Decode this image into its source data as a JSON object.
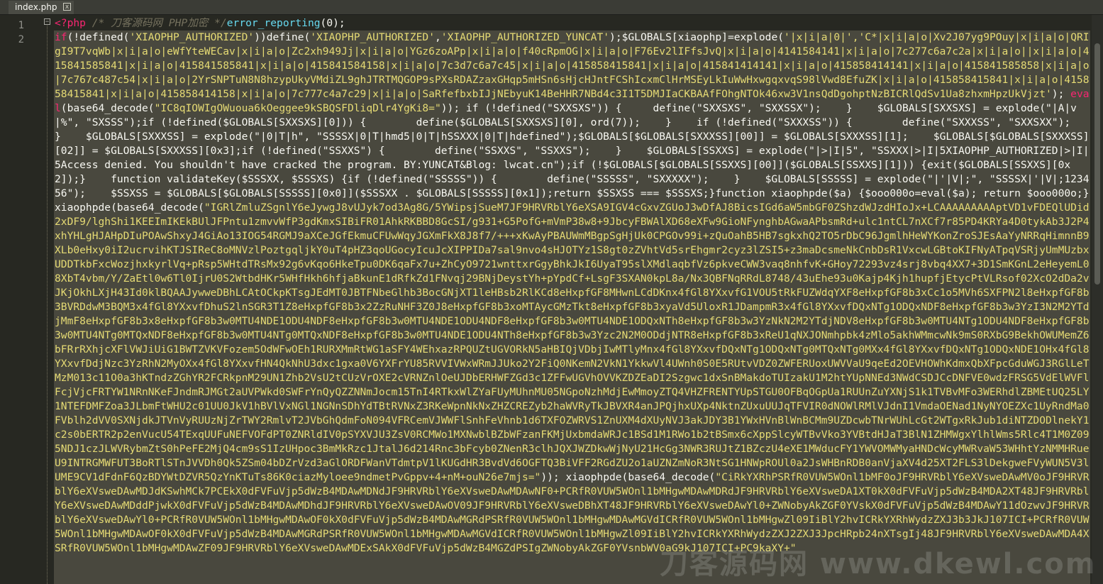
{
  "tab": {
    "title": "index.php",
    "close_glyph": "x"
  },
  "gutter": {
    "lines": [
      "1",
      "2"
    ]
  },
  "fold_glyph": "−",
  "line1": {
    "open_tag": "<?php",
    "comment": " /* 刀客源码网 PHP加密 */",
    "statement": "error_reporting",
    "arg": "(0);"
  },
  "code": {
    "p1_kw": "if",
    "p1": "(!defined(",
    "p1_s1": "'XIAOPHP_AUTHORIZED'",
    "p1b": "))define(",
    "p1_s2": "'XIAOPHP_AUTHORIZED'",
    "p1c": ",",
    "p1_s3": "'XIAOPHP_AUTHORIZED_YUNCAT'",
    "p1d": ");$GLOBALS[xiaophp]=explode(",
    "blob1": "'|x|i|a|0|','C*|x|i|a|o|Xv2J07yg9POuy|x|i|a|o|QRIgI9T7vqWb|x|i|a|o|eWfYteWECav|x|i|a|o|Zc2xh949Jj|x|i|a|o|YGz6zoAPp|x|i|a|o|f40cRpmOG|x|i|a|o|F76Ev2lIFfsJvQ|x|i|a|o|4141584141|x|i|a|o|7c277c6a7c2a|x|i|a|o||x|i|a|o|415841585841|x|i|a|o|415841585841|x|i|a|o|415841584158|x|i|a|o|7c3d7c6a7c45|x|i|a|o|415858415841|x|i|a|o|415841414141|x|i|a|o|415858414141|x|i|a|o|415841585858|x|i|a|o|7c767c487c54|x|i|a|o|2YrSNPTuN8N8hzypUkyVMdiZL9ghJTRTMQGOP9sPXsRDAZzaxGHqp5mHSn6sHjcHJntFCShIcxmClHrMSEyLkIuWwHxwgqxvqS98lVwd8EfuZK|x|i|a|o|415858415841|x|i|a|o|415858415841|x|i|a|o|415858414158|x|i|a|o|7c777c4a7c29|x|i|a|o|SaRfefbxbIJjNEbyuK14BeHHR7NBd4c3I1T5DMJIaCKBAAfFOhgNTOk46xw3V1nsQdDgohptNzBICRlQdSv1Ua8zhxmHpzUkVjzt'",
    "p2": "); ",
    "eval_kw": "eval",
    "p3": "(base64_decode(",
    "blob2": "\"IC8qIOWIgOWuoua6kOeggee9kSBQSFDliqDlr4YgKi8=\"",
    "p4": ")); if (!defined(\"SXXSXS\")) {     define(\"SXXSXS\", \"SXXSSX\");    }    $GLOBALS[SXXSXS] = explode(\"|A|v|%\", \"SXSSS\");if (!defined($GLOBALS[SXXSXS][0])) {        define($GLOBALS[SXXSXS][0], ord(7));    }    if (!defined(\"SXXXSS\")) {        define(\"SXXXSS\", \"SXXSXX\");    }    $GLOBALS[SXXXSS] = explode(\"|0|T|h\", \"SSSSX|0|T|hmd5|0|T|hSSXXX|0|T|hdefined\");$GLOBALS[$GLOBALS[SXXXSS][00]] = $GLOBALS[SXXXSS][1];    $GLOBALS[$GLOBALS[SXXXSS][02]] = $GLOBALS[SXXXSS][0x3];if (!defined(\"SSXXS\") {        define(\"SSXXS\", \"SSXXS\");    }    $GLOBALS[SSXXS] = explode(\"|>|I|5\", \"SSXXX|>|I|5XIAOPHP_AUTHORIZED|>|I|5Access denied. You shouldn't have cracked the program. BY:YUNCAT&Blog: lwcat.cn\");if (!$GLOBALS[$GLOBALS[SSXXS][00]]($GLOBALS[SSXXS][1])) {exit($GLOBALS[SSXXS][0x2]);}    function validateKey($SSSXX, $SSSXS) {if (!defined(\"SSSSS\")) {        define(\"SSSSS\", \"SXXXXX\");    }    $GLOBALS[SSSSS] = explode(\"|'|V|;\", \"SSSSX|'|V|;123456\");    $SSXSS = $GLOBALS[$GLOBALS[SSSSS][0x0]]($SSSXX . $GLOBALS[SSSSS][0x1]);return $SSXSS === $SSSXS;}function xiaophpde($a) {$ooo000o=eval($a); return $ooo000o;}     xiaophpde(base64_decode(",
    "blob3": "\"IGRlZmluZSgnlY6eJywgJ8vUJyk7od3Ag8G/5YWipsjSueM7JF9HRVRblY6eXSA9IGV4cGxvZGUoJ3wDfAJ8BicsIGd6aW5mbGF0ZShzdWJzdHIoJx+LCAAAAAAAAAptVD1vFDEQlUDid2xDF9/lghShi1KEEImIKEkBUlJFPntu1zmvvWfP3gdKmxSIBiFR01AhkRKBBD8GcSI/g931+G5PofG+mVmP38w8+9JbcyFBWAlXD68eXFw9GioNFynghbAGwaAPbsmRd+ulc1ntCL7nXCf7r85PD4KRYa4D0tykAb3J2P4xhYHLgHJAHpDIuPOAwShxyJ4GiAo13IOG54RGMJ9aXCeJGfEkmuCFUwWqyJGXmFkX8J8f7/+++xKwAyPBAUWmMBgpSgHjUk0CPGOv99i+zQuOahB5HB7sgkxhQ2TO5rDbC96JgmlhHeWYKonZroSJEsAaYyNRRqHimnnB9XLb0eHxy0iI2ucrvihKTJSIReC8oMNVzlPoztgqljkY0uT4pHZ3qoUGocyIcuJcXIPPIDa7sal9nvo4sHJOTYz1S8gt0zZVhtVd5srEhgmr2cyz3lZSI5+z3maDcsmeNkCnbDsR1VxcwLGBtoKIFNyATpqVSRjyUmMUzbxUDDTkbFxcWozjhxkyrlVq+pRsp5WHtdTRsMx92g6vKqo6HkeTpu0DK6qaFx7u+ZhCyO9721wnttxrGgyBhkJkI6UyaT95slXMdlaqbfVz6pkveCWW3vaq8nhfvK+GHoy72293vz4srj8vbq4XX7+3D1SmKGnL2eHeyemL08XbT4vbm/Y/ZaEtl0w6Tl0IjrU0S2WtbdHKr5WHfHkh6hfjaBkunE1dRfkZd1FNvqj29BNjDeystYh+pYpdCf+LsgF3SXAN0kpL8a/Nx3QBFNqRRdL8748/43uEhe93u0Kajp4Kjh1hupfjEtycPtVLRsof02XcO2dDa2vJKjOkhLXjH43Id0klBQAAJywweDBhLCAtOCkpKTsgJEdMT0JBTFNbeGlhb3BocGNjXT1leHBsb2RlKCd8eHxpfGF8MHwnLCdDKnx4fGl8YXxvfG1VOU5tRkFUZWdqYXF8eHxpfGF8b3xCc1o5MVh6SXFPN2l8eHxpfGF8b3BVRDdwM3BQM3x4fGl8YXxvfDhuS2lnSGR3T1Z8eHxpfGF8b3x2ZzRuNHF3Z0J8eHxpfGF8b3xoMTAycGMzTkt8eHxpfGF8b3xyaVd5UloxR1JDampmR3x4fGl8YXxvfDQxNTg1ODQxNDF8eHxpfGF8b3w3YzI3N2M2YTdjMmF8eHxpfGF8b3x8eHxpfGF8b3w0MTU4NDE1ODU4NDF8eHxpfGF8b3w0MTU4NDE1ODU4NDF8eHxpfGF8b3w0MTU4NDE1ODQxNTh8eHxpfGF8b3w3YzNkN2M2YTdjNDV8eHxpfGF8b3w0MTU4NTg1ODU4NDF8eHxpfGF8b3w0MTU4NTg0MTQxNDF8eHxpfGF8b3w0MTU4NTg0MTQxNDF8eHxpfGF8b3w0MTU4NDE1ODU4NTh8eHxpfGF8b3w3Yzc2N2M0ODdjNTR8eHxpfGF8b3xReU1qNXJONmhpbk4zMlo5akhWMmcwNk9mS0RXbG9BekhOWUMemZ6bFRrRXhjcXFlVWJiUiG1BWTZVKVFozem5OdWFwOEh1RURXMmRtWG1aSFY4WEhxazRPQUZtUGVORkN5aHBIQjVDbjIwMTlyMnx4fGl8YXxvfDQxNTg1ODQxNTg0MTQxNTg0MXx4fGl8YXxvfDQxNTg1ODQxNDE1OHx4fGl8YXxvfDdjNzc3YzRhN2MyOXx4fGl8YXxvfHN4QkNhU3dxc1gxa0V6YXFrYU85RVVIVWxWRmJJUko2Y2FiQ0NKemN2VkN1YkkwVl4UWnh0S0E5RUtvVDZ0ZWFERUoxUWVVaU9qeEd2OEVHOWhKdmxQbXFpcGduWGJ3RGlLeTMzM013c11O0a3hKTndzZGhYR2FCRkpnM29UN1Zhb2VsU2tCUzVrOXE2cVRNZnlOeUJDbERHWFZGd3c1ZFFwUGVhOVVKZDZEaDI2Szgwc1dxSnBMakdoTUIzakU1M2htYUpNNEd3NWdCSDJCcDNFVE0wdzFRSG5VdElWVFlFcjVjcFRTYW1NRnNKeFJndmRJMGt2aUVPWkd0SWFrYnQyQZZNNmJocm15TnI4RTkxWlZYaFUyMUhnMU05NGpoNzhMdjEwMmoyZTQ4VHZFRENTYUpSTGU0OFBqOGpUa1RUUnZuYXNjS1k1TVBvMFo3WERhdlZBMEtUQ25LY1NTEFDMFZoa3JLbmFtWHU2c01UU0JkV1hBVlVxNGl1NGNnSDhYdTBtRVNxZ3RKeWpnNkNxZHZCREZyb2haWVRyTkJBVXR4anJPQjhxUXp4NktnZUxuUUJqTFVIR0dNOWlRMlVJdnI1VmdaOENad1NyNYOEZXc1UyRndMa0FVblh2dVV0SXNjdkJTVnVyRUUzNjZrTWY2RmlvT2JVbGhQdmFoN094VFRCemVJWWFlSnhFeVhnb1d6TXFOZWRVS1ZnUXM4dXUyNVJ3akJDY3B1YWxHVnBlWnBCMm9UZDcwbTNrWUhLcGt2WTgxRkJub1diNTZDODlnekY1c2s0bERTR2p2enVucU54TExqUUFuNEFVOFdPT0ZNRldIV0pSYXVJU3ZsV0RCMWo1MXNwblBZbWFzanFKMjUxbmdaWRJc1BSd1M1RWo1b2tBSmx6cXppSlcyWTBvVko3YVBtdHJaT3BlN1ZHMWgxYlhlWms5Rlc4T1M0Z095NDJ1czJLWVRybmZtS0hPeFE2MjQ4cm9sS1IzUHpoc3BmMkRzc1JtalJ6d214Rnc3bFcyb0ZNenR3clhJQXJWZDkwWjNyU21HcGg3NWR3RUJtZ1BZczU4eXE1MWducFY1YWVOMWMyaHNDcWcyMWRvaW53WHhtYzNMMHRueU9INTRGMWFUT3BoRTlSTnJVVDh0Qk5ZSm04bDZrVzd3aGlORDFWanVTdmtpV1lKUGdHR3BvdVd6OGFTQ3BiVFF2RGdZU2o1aUZNZmNoR3NtSG1HNWpROUl0a2JsWHBnRDB0anVjaXV4d25XT2FLS3lDekgweFVyWUN5V3lUME9CV1dFdnF6QzBDYWtDZVR5QzYnKTuTs86K0ciazMyloee9ndmetPvGppv+4+nM+ouN26e7mjs=\"",
    "p5": ")); xiaophpde(base64_decode(",
    "blob4": "\"CiRkYXRhPSRfR0VUW5WOnl1bMF0oJF9HRVRblY6eXVsweDAwMV0oJF9HRVRblY6eXVsweDAwMDJdKSwhMCk7PCEkX0dFVFuVjp5dWzB4MDAwMDNdJF9HRVRblY6eXVsweDAwMDAwNF0+PCRfR0VUW5WOnl1bMHgwMDAwMDRdJF9HRVRblY6eXVsweDA1XT0kX0dFVFuVjp5dWzB4MDA2XT48JF9HRVRblY6eXVsweDAwMDddPjwkX0dFVFuVjp5dWzB4MDAwMDhdJF9HRVRblY6eXVsweDAwOV09JF9HRVRblY6eXVsweDBhXT48JF9HRVRblY6eXVsweDAwYl0+ZWNobyAkZGF0YVskX0dFVFuVjp5dWzB4MDAwY11dOzwvJF9HRVRblY6eXVsweDAwYl0+PCRfR0VUW5WOnl1bMHgwMDAwOF0kX0dFVFuVjp5dWzB4MDAwMGRdPSRfR0VUW5WOnl1bMHgwMDAwMGVdICRfR0VUW5WOnl1bMHgwZl09IiBlY2hvICRkYXRhWydzZXJ3b3JkJ107ICI+PCRfR0VUW5WOnl1bMHgwMDAwOF0kX0dFVFuVjp5dWzB4MDAwMGRdPSRfR0VUW5WOnl1bMHgwMDAwMGVdICRfR0VUW5WOnl1bMHgwZl09IiBlY2hvICRkYXRhWydzZXJ2ZXJ3JpcHRpb24nXTsgIj48JF9HRVRblY6eXVsweDAwMDA4XSRfR0VUW5WOnl1bMHgwMDAwZF09JF9HRVRblY6eXVsweDAwMDExSAkX0dFVFuVjp5dWzB4MGZdPSIgZWNobyAkZGF0YVsnbWV0aG9kJ107ICI+PC9kaXY+\""
  },
  "watermark": "刀客源码网 www.dkewl.com"
}
